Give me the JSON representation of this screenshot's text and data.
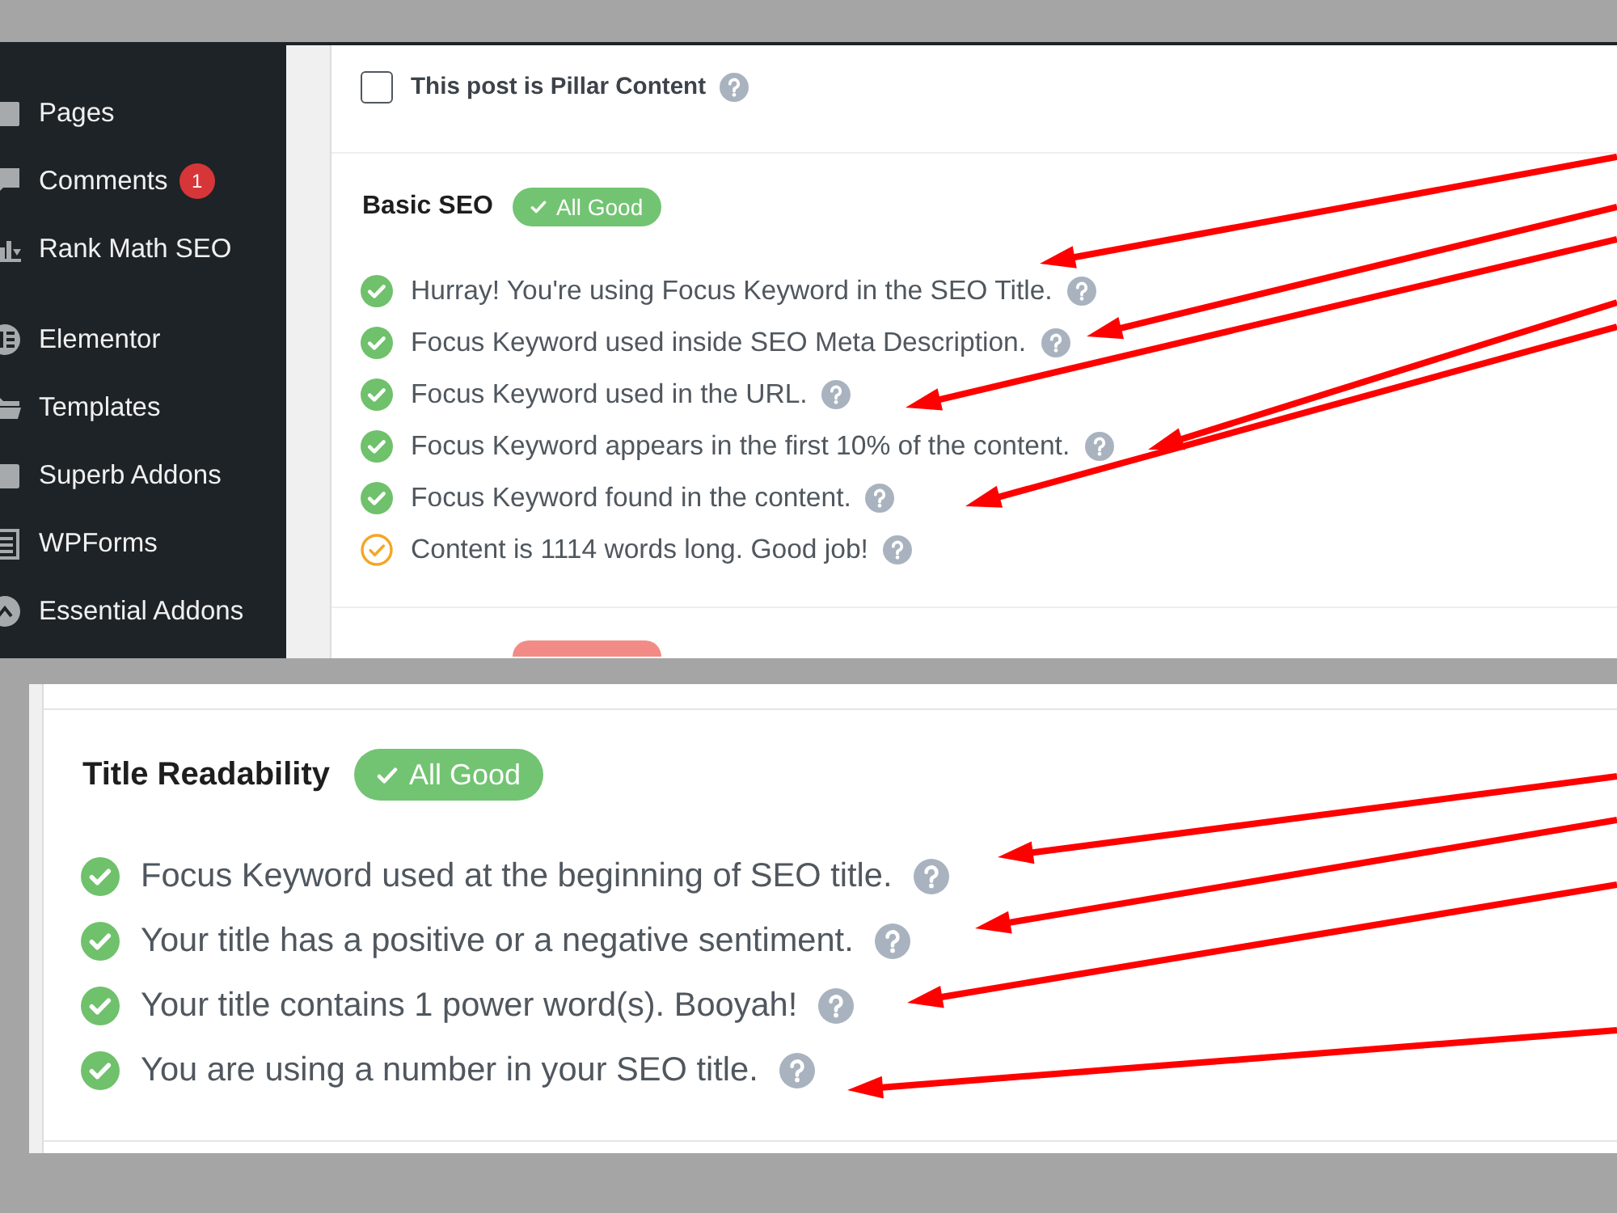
{
  "sidebar": {
    "groups": [
      {
        "items": [
          {
            "label": "Pages",
            "selected": false
          },
          {
            "label": "Comments",
            "badge": "1",
            "selected": false
          },
          {
            "label": "Rank Math SEO",
            "selected": false
          }
        ]
      },
      {
        "items": [
          {
            "label": "Elementor",
            "selected": false
          },
          {
            "label": "Templates",
            "selected": false
          },
          {
            "label": "Superb Addons",
            "selected": false
          },
          {
            "label": "WPForms",
            "selected": false
          },
          {
            "label": "Essential Addons",
            "selected": false
          }
        ]
      }
    ]
  },
  "pillar_content": {
    "label": "This post is Pillar Content",
    "checked": false
  },
  "seo_sections": [
    {
      "title": "Basic SEO",
      "badge": {
        "label": "All Good",
        "error": false
      },
      "checks": [
        {
          "text": "Hurray! You're using Focus Keyword in the SEO Title.",
          "warning": false,
          "arrow": true
        },
        {
          "text": "Focus Keyword used inside SEO Meta Description.",
          "warning": false,
          "arrow": true
        },
        {
          "text": "Focus Keyword used in the URL.",
          "warning": false,
          "arrow": true
        },
        {
          "text": "Focus Keyword appears in the first 10% of the content.",
          "warning": false,
          "arrow": true
        },
        {
          "text": "Focus Keyword found in the content.",
          "warning": false,
          "arrow": true
        },
        {
          "text": "Content is 1114 words long. Good job!",
          "warning": true,
          "arrow": false
        }
      ]
    },
    {
      "badge": {
        "error": true
      }
    }
  ],
  "title_readability": {
    "title": "Title Readability",
    "badge": {
      "label": "All Good",
      "error": false
    },
    "checks": [
      {
        "text": "Focus Keyword used at the beginning of SEO title.",
        "warning": false,
        "arrow": true
      },
      {
        "text": "Your title has a positive or a negative sentiment.",
        "warning": false,
        "arrow": true
      },
      {
        "text": "Your title contains 1 power word(s). Booyah!",
        "warning": false,
        "arrow": true
      },
      {
        "text": "You are using a number in your SEO title.",
        "warning": false,
        "arrow": true
      }
    ]
  }
}
